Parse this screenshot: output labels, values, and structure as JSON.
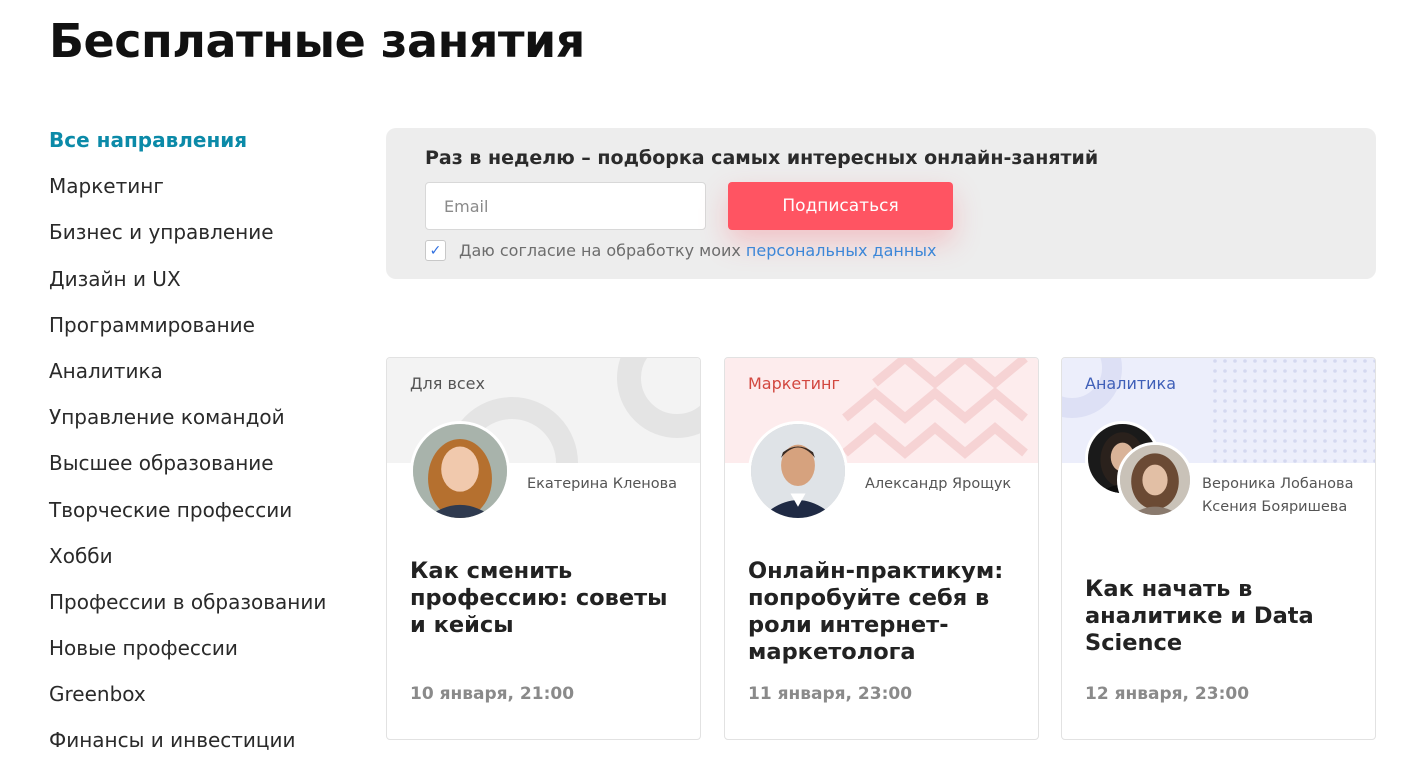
{
  "page_title": "Бесплатные занятия",
  "sidebar": {
    "items": [
      {
        "label": "Все направления",
        "active": true
      },
      {
        "label": "Маркетинг"
      },
      {
        "label": "Бизнес и управление"
      },
      {
        "label": "Дизайн и UX"
      },
      {
        "label": "Программирование"
      },
      {
        "label": "Аналитика"
      },
      {
        "label": "Управление командой"
      },
      {
        "label": "Высшее образование"
      },
      {
        "label": "Творческие профессии"
      },
      {
        "label": "Хобби"
      },
      {
        "label": "Профессии в образовании"
      },
      {
        "label": "Новые профессии"
      },
      {
        "label": "Greenbox"
      },
      {
        "label": "Финансы и инвестиции"
      }
    ]
  },
  "subscribe": {
    "heading": "Раз в неделю – подборка самых интересных онлайн-занятий",
    "email_placeholder": "Email",
    "button_label": "Подписаться",
    "consent_checked": true,
    "consent_text": "Даю согласие на обработку моих",
    "consent_link": "персональных данных",
    "button_color": "#ff5462",
    "link_color": "#3c87d8"
  },
  "cards": [
    {
      "category": "Для всех",
      "speakers": [
        "Екатерина Кленова"
      ],
      "title": "Как сменить профессию: советы и кейсы",
      "date": "10 января, 21:00"
    },
    {
      "category": "Маркетинг",
      "speakers": [
        "Александр Ярощук"
      ],
      "title": "Онлайн-практикум: попробуйте себя в роли интернет-маркетолога",
      "date": "11 января, 23:00"
    },
    {
      "category": "Аналитика",
      "speakers": [
        "Вероника Лобанова",
        "Ксения Бояришева"
      ],
      "title": "Как начать в аналитике и Data Science",
      "date": "12 января, 23:00"
    }
  ],
  "colors": {
    "accent": "#0b8aa8",
    "marketing": "#d2473f",
    "analytics": "#3f5fb8"
  }
}
